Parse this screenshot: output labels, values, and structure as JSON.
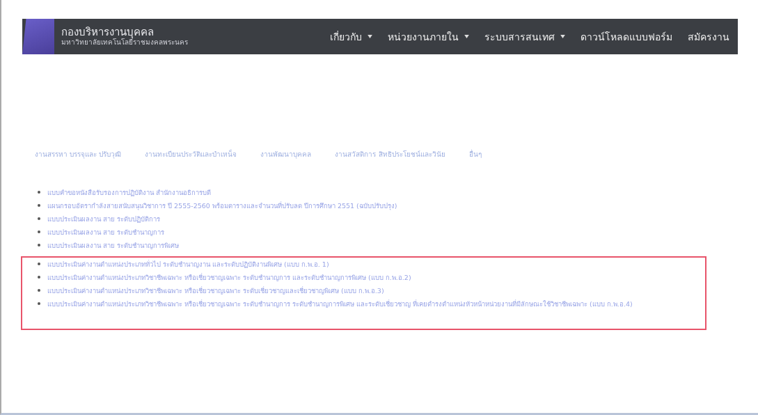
{
  "header": {
    "title": "กองบริหารงานบุคคล",
    "subtitle": "มหาวิทยาลัยเทคโนโลยีราชมงคลพระนคร",
    "nav": [
      {
        "label": "เกี่ยวกับ",
        "dropdown": true
      },
      {
        "label": "หน่วยงานภายใน",
        "dropdown": true
      },
      {
        "label": "ระบบสารสนเทศ",
        "dropdown": true
      },
      {
        "label": "ดาวน์โหลดแบบฟอร์ม",
        "dropdown": false
      },
      {
        "label": "สมัครงาน",
        "dropdown": false
      }
    ]
  },
  "tabs": [
    "งานสรรหา บรรจุและ ปรับวุฒิ",
    "งานทะเบียนประวัติและบำเหน็จ",
    "งานพัฒนาบุคคล",
    "งานสวัสดิการ สิทธิประโยชน์และวินัย",
    "อื่นๆ"
  ],
  "documents": [
    {
      "text": "แบบคำขอหนังสือรับรองการปฏิบัติงาน สำนักงานอธิการบดี",
      "highlighted": false
    },
    {
      "text": "แผนกรอบอัตรากำลังสายสนับสนุนวิชาการ ปี 2555-2560 พร้อมตารางและจำนวนที่ปรับลด ปีการศึกษา 2551 (ฉบับปรับปรุง)",
      "highlighted": false
    },
    {
      "text": "แบบประเมินผลงาน สาย ระดับปฏิบัติการ",
      "highlighted": false
    },
    {
      "text": "แบบประเมินผลงาน สาย ระดับชำนาญการ",
      "highlighted": false
    },
    {
      "text": "แบบประเมินผลงาน สาย ระดับชำนาญการพิเศษ",
      "highlighted": false
    },
    {
      "text": "แบบประเมินค่างานตำแหน่งประเภททั่วไป ระดับชำนาญงาน และระดับปฏิบัติงานพิเศษ (แบบ ก.พ.อ. 1)",
      "highlighted": true
    },
    {
      "text": "แบบประเมินค่างานตำแหน่งประเภทวิชาชีพเฉพาะ หรือเชี่ยวชาญเฉพาะ ระดับชำนาญการ และระดับชำนาญการพิเศษ (แบบ ก.พ.อ.2)",
      "highlighted": true
    },
    {
      "text": "แบบประเมินค่างานตำแหน่งประเภทวิชาชีพเฉพาะ หรือเชี่ยวชาญเฉพาะ ระดับเชี่ยวชาญและเชี่ยวชาญพิเศษ (แบบ ก.พ.อ.3)",
      "highlighted": true
    },
    {
      "text": "แบบประเมินค่างานตำแหน่งประเภทวิชาชีพเฉพาะ หรือเชี่ยวชาญเฉพาะ ระดับชำนาญการ ระดับชำนาญการพิเศษ และระดับเชี่ยวชาญ ที่เคยดำรงตำแหน่งหัวหน้าหน่วยงานที่มีลักษณะใช้วิชาชีพเฉพาะ (แบบ ก.พ.อ.4)",
      "highlighted": true
    }
  ]
}
